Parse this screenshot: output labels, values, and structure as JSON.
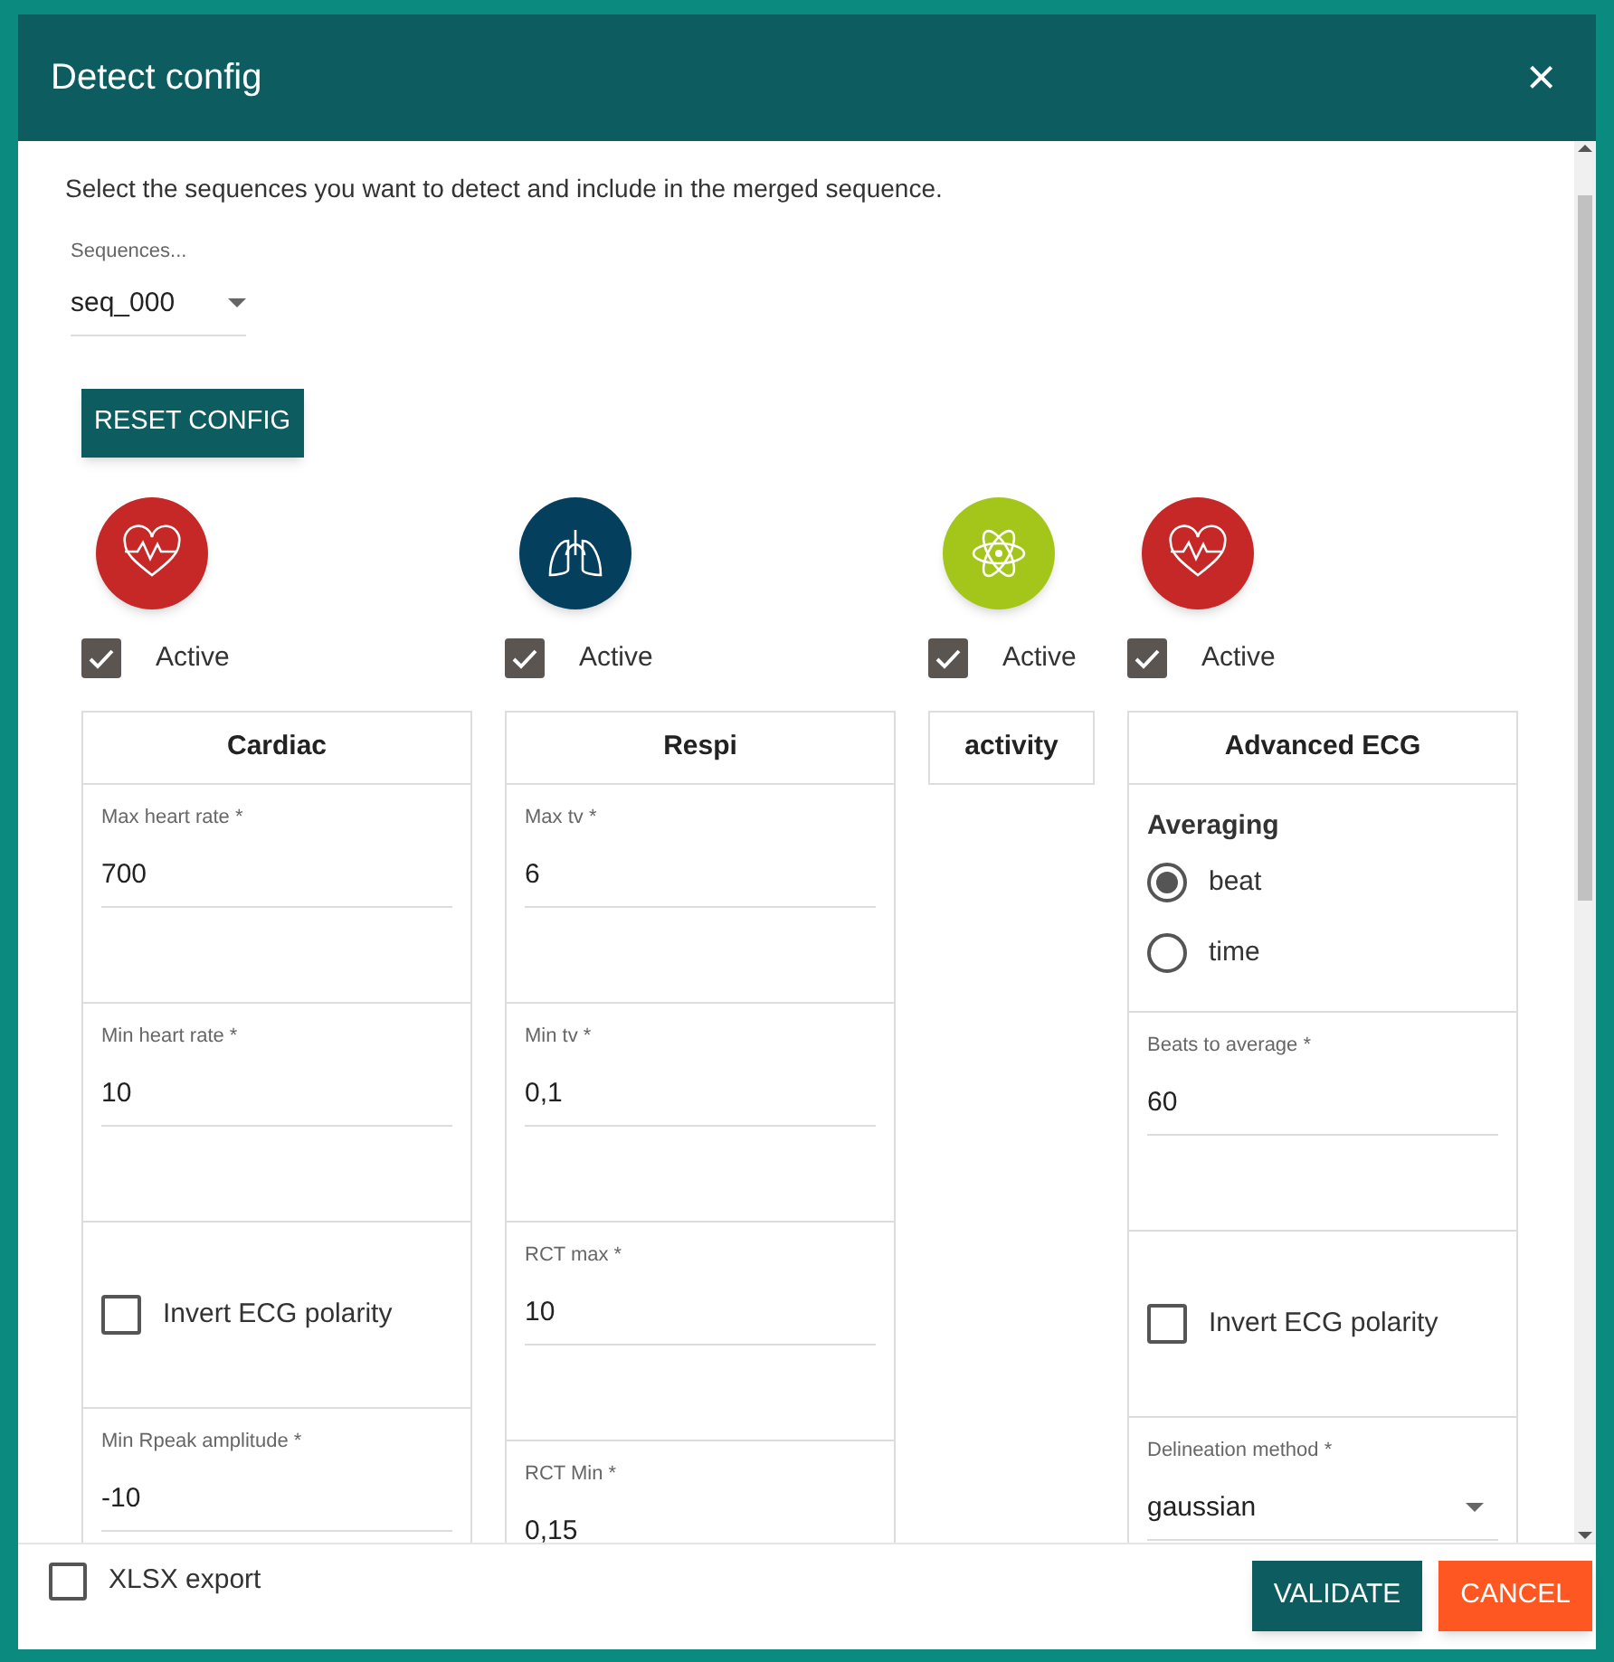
{
  "window": {
    "title": "Detect config",
    "close": "×"
  },
  "intro": "Select the sequences you want to detect and include in the merged sequence.",
  "sequences": {
    "label": "Sequences...",
    "value": "seq_000"
  },
  "reset_button": "RESET CONFIG",
  "modules": [
    {
      "color": "#c62828",
      "active": true,
      "active_label": "Active",
      "title": "Cardiac",
      "sections": [
        {
          "kind": "field",
          "label": "Max heart rate *",
          "value": "700"
        },
        {
          "kind": "field",
          "label": "Min heart rate *",
          "value": "10"
        },
        {
          "kind": "checkbox",
          "label": "Invert ECG polarity",
          "checked": false
        },
        {
          "kind": "field",
          "label": "Min Rpeak amplitude *",
          "value": "-10"
        }
      ]
    },
    {
      "color": "#053f5e",
      "active": true,
      "active_label": "Active",
      "title": "Respi",
      "sections": [
        {
          "kind": "field",
          "label": "Max tv *",
          "value": "6"
        },
        {
          "kind": "field",
          "label": "Min tv *",
          "value": "0,1"
        },
        {
          "kind": "field",
          "label": "RCT max *",
          "value": "10"
        },
        {
          "kind": "field",
          "label": "RCT Min *",
          "value": "0,15"
        }
      ]
    },
    {
      "color": "#a4c61a",
      "active": true,
      "active_label": "Active",
      "title": "activity"
    },
    {
      "color": "#c62828",
      "active": true,
      "active_label": "Active",
      "title": "Advanced ECG",
      "sections": [
        {
          "kind": "radio",
          "label": "Averaging",
          "options": [
            {
              "label": "beat",
              "selected": true
            },
            {
              "label": "time",
              "selected": false
            }
          ]
        },
        {
          "kind": "field",
          "label": "Beats to average *",
          "value": "60"
        },
        {
          "kind": "checkbox",
          "label": "Invert ECG polarity",
          "checked": false
        },
        {
          "kind": "select",
          "label": "Delineation method *",
          "value": "gaussian"
        }
      ]
    }
  ],
  "footer": {
    "xlsx_export": {
      "label": "XLSX export",
      "checked": false
    },
    "buttons": [
      {
        "kind": "primary",
        "label": "VALIDATE"
      },
      {
        "kind": "cancel",
        "label": "CANCEL"
      }
    ]
  }
}
